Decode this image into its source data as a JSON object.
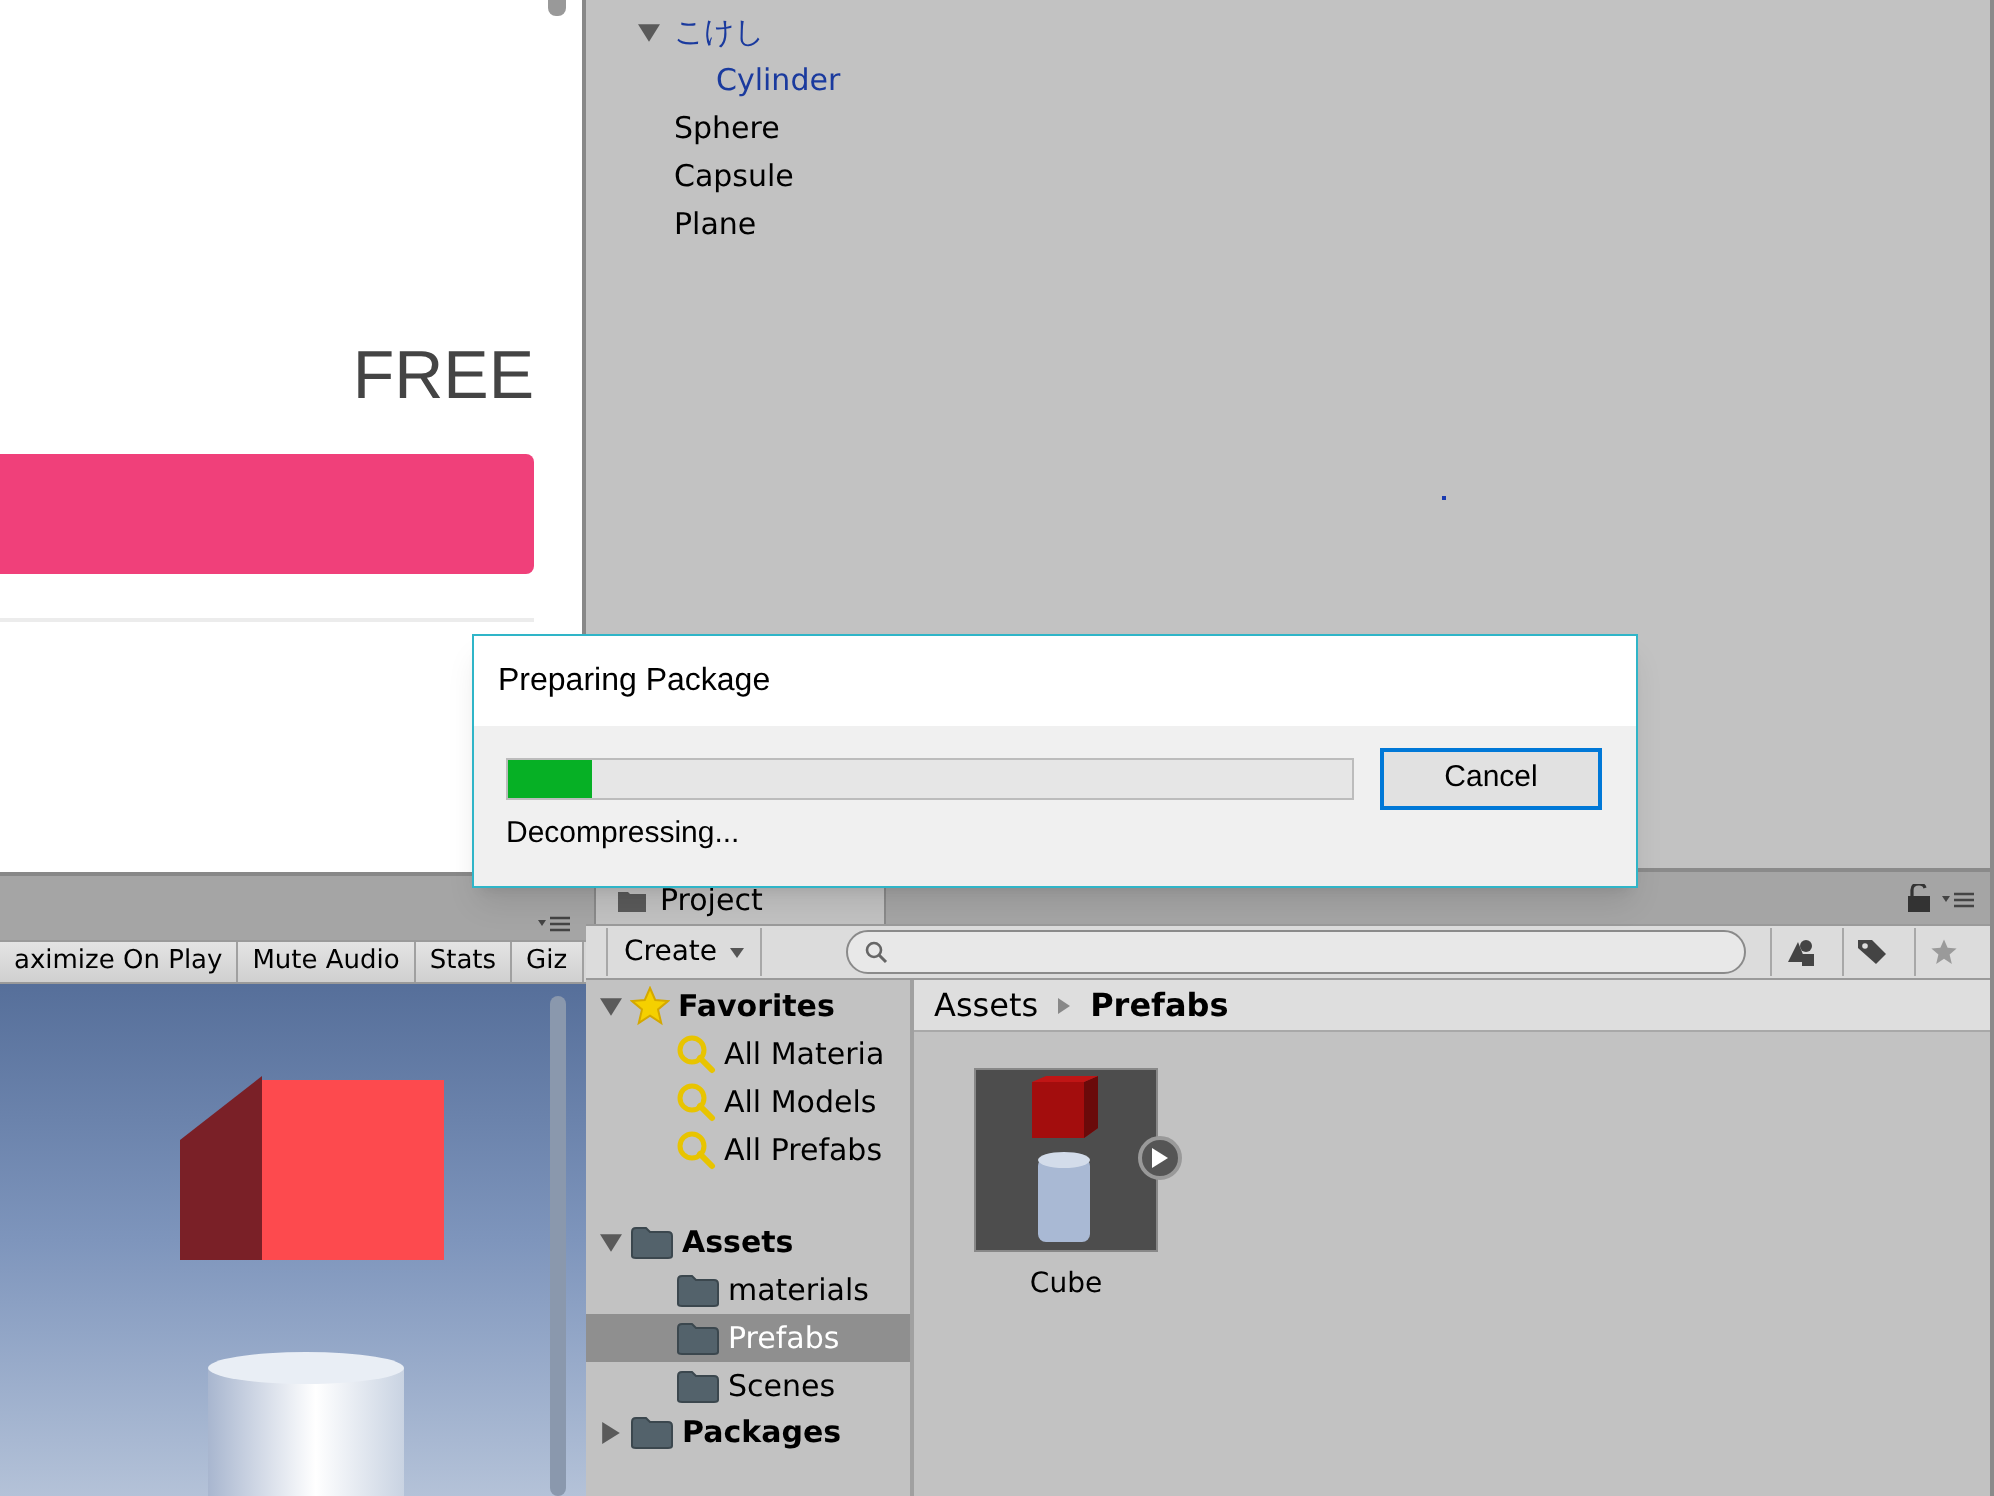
{
  "store_panel": {
    "price": "FREE"
  },
  "game_view": {
    "toolbar_buttons": [
      "aximize On Play",
      "Mute Audio",
      "Stats",
      "Giz"
    ]
  },
  "hierarchy": {
    "items": [
      {
        "label": "こけし",
        "prefab": true,
        "expanded": true,
        "children": [
          {
            "label": "Cylinder",
            "prefab": true
          }
        ]
      },
      {
        "label": "Sphere",
        "prefab": false
      },
      {
        "label": "Capsule",
        "prefab": false
      },
      {
        "label": "Plane",
        "prefab": false
      }
    ]
  },
  "project": {
    "tab": "Project",
    "create_button": "Create",
    "sidebar": [
      {
        "label": "Favorites",
        "kind": "favorites",
        "expanded": true,
        "selected": false,
        "children": [
          {
            "label": "All Materia",
            "kind": "search",
            "selected": false
          },
          {
            "label": "All Models",
            "kind": "search",
            "selected": false
          },
          {
            "label": "All Prefabs",
            "kind": "search",
            "selected": false
          }
        ]
      },
      {
        "label": "Assets",
        "kind": "folder",
        "expanded": true,
        "selected": false,
        "children": [
          {
            "label": "materials",
            "kind": "folder",
            "selected": false
          },
          {
            "label": "Prefabs",
            "kind": "folder",
            "selected": true
          },
          {
            "label": "Scenes",
            "kind": "folder",
            "selected": false
          }
        ]
      },
      {
        "label": "Packages",
        "kind": "folder",
        "expanded": false,
        "selected": false
      }
    ],
    "breadcrumb": [
      "Assets",
      "Prefabs"
    ],
    "assets": [
      {
        "name": "Cube"
      }
    ]
  },
  "dialog": {
    "title": "Preparing Package",
    "level": 0.1,
    "status": "Decompressing...",
    "button": "Cancel"
  }
}
